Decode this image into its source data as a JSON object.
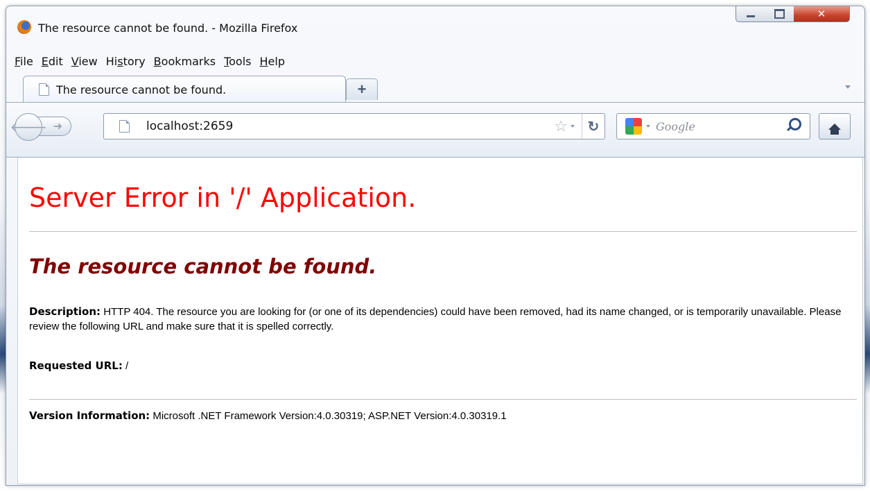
{
  "window": {
    "title": "The resource cannot be found. - Mozilla Firefox"
  },
  "menu": [
    {
      "u": "F",
      "rest": "ile"
    },
    {
      "u": "E",
      "rest": "dit"
    },
    {
      "u": "V",
      "rest": "iew"
    },
    {
      "pre": "Hi",
      "u": "s",
      "rest": "tory"
    },
    {
      "u": "B",
      "rest": "ookmarks"
    },
    {
      "u": "T",
      "rest": "ools"
    },
    {
      "u": "H",
      "rest": "elp"
    }
  ],
  "tab": {
    "label": "The resource cannot be found.",
    "new_tab": "+"
  },
  "nav": {
    "url": "localhost:2659",
    "search_placeholder": "Google"
  },
  "page": {
    "heading": "Server Error in '/' Application.",
    "subheading": "The resource cannot be found.",
    "description_label": "Description:",
    "description_text": "HTTP 404. The resource you are looking for (or one of its dependencies) could have been removed, had its name changed, or is temporarily unavailable.  Please review the following URL and make sure that it is spelled correctly.",
    "requested_url_label": "Requested URL:",
    "requested_url_value": "/",
    "version_label": "Version Information:",
    "version_text": "Microsoft .NET Framework Version:4.0.30319; ASP.NET Version:4.0.30319.1"
  },
  "colors": {
    "heading": "#ff0000",
    "subheading": "#800000"
  }
}
